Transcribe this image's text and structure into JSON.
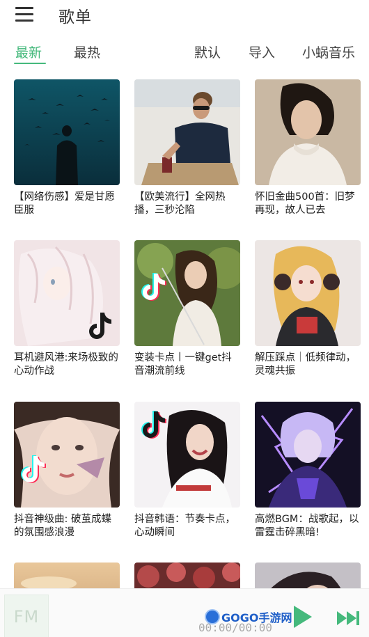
{
  "header": {
    "title": "歌单",
    "menu_icon": "hamburger-menu-icon"
  },
  "tabs": [
    {
      "label": "最新",
      "active": true
    },
    {
      "label": "最热",
      "active": false
    },
    {
      "label": "默认",
      "active": false
    },
    {
      "label": "导入",
      "active": false
    },
    {
      "label": "小蜗音乐",
      "active": false
    }
  ],
  "accent_color": "#45b97c",
  "playlists": [
    {
      "title": "【网络伤感】爱是甘愿臣服",
      "cover": "dark-teal-silhouette-birds"
    },
    {
      "title": "【欧美流行】全网热播，三秒沦陷",
      "cover": "man-sunglasses-blue-tee"
    },
    {
      "title": "怀旧金曲500首：旧梦再现，故人已去",
      "cover": "vintage-woman-lace-collar"
    },
    {
      "title": "耳机避风港:来场极致的心动作战",
      "cover": "anime-pastel-girl",
      "badge": "tiktok-icon"
    },
    {
      "title": "变装卡点丨一键get抖音潮流前线",
      "cover": "girl-with-sword-garden",
      "badge": "tiktok-icon"
    },
    {
      "title": "解压踩点｜低频律动，灵魂共振",
      "cover": "anime-blonde-girl-headphones"
    },
    {
      "title": "抖音神级曲: 破茧成蝶的氛围感浪漫",
      "cover": "girl-butterfly-closeup",
      "badge": "tiktok-icon"
    },
    {
      "title": "抖音韩语：节奏卡点，心动瞬间",
      "cover": "smiling-girl-white-jacket",
      "badge": "tiktok-icon"
    },
    {
      "title": "高燃BGM：战歌起，以雷霆击碎黑暗!",
      "cover": "anime-purple-lightning-boy"
    },
    {
      "title": "",
      "cover": "sunset-clouds"
    },
    {
      "title": "",
      "cover": "red-flowers"
    },
    {
      "title": "",
      "cover": "girl-portrait"
    }
  ],
  "player": {
    "fm_label": "FM",
    "time": "00:00/00:00",
    "watermark": "GOGO手游网",
    "play_icon": "play-icon",
    "next_icon": "next-track-icon"
  }
}
